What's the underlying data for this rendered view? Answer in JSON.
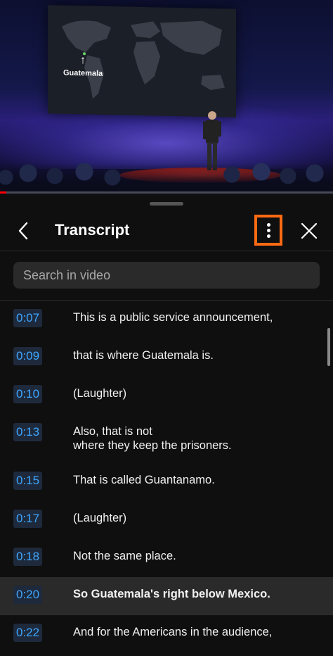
{
  "video": {
    "slide_label": "Guatemala",
    "progress_fraction": 0.02
  },
  "panel": {
    "title": "Transcript",
    "search_placeholder": "Search in video",
    "accent_color": "#ff6a13",
    "timestamp_color": "#3ea6ff"
  },
  "segments": [
    {
      "time": "0:07",
      "text": "This is a public service announcement,",
      "active": false
    },
    {
      "time": "0:09",
      "text": "that is where Guatemala is.",
      "active": false
    },
    {
      "time": "0:10",
      "text": "(Laughter)",
      "active": false
    },
    {
      "time": "0:13",
      "text": "Also, that is not\nwhere they keep the prisoners.",
      "active": false
    },
    {
      "time": "0:15",
      "text": "That is called Guantanamo.",
      "active": false
    },
    {
      "time": "0:17",
      "text": "(Laughter)",
      "active": false
    },
    {
      "time": "0:18",
      "text": "Not the same place.",
      "active": false
    },
    {
      "time": "0:20",
      "text": "So Guatemala's right below Mexico.",
      "active": true
    },
    {
      "time": "0:22",
      "text": "And for the Americans in the audience,",
      "active": false
    }
  ],
  "icons": {
    "back": "chevron-left-icon",
    "more": "more-vertical-icon",
    "close": "close-icon"
  }
}
